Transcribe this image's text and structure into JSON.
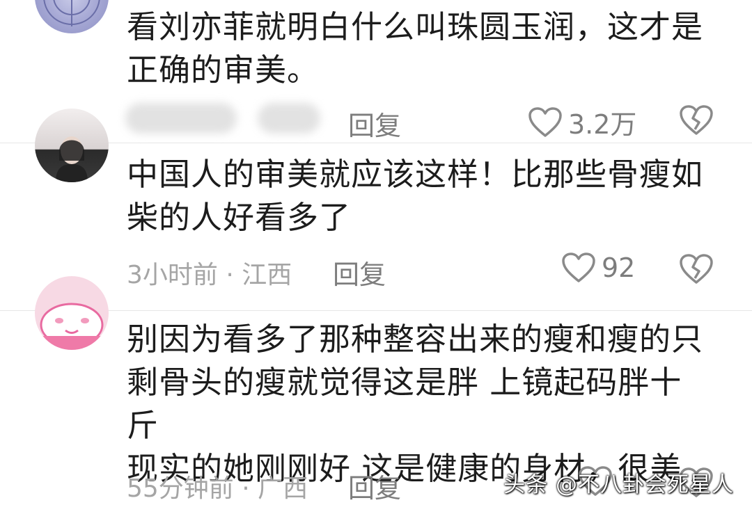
{
  "comments": [
    {
      "text": "看刘亦菲就明白什么叫珠圆玉润，这才是\n正确的审美。",
      "meta": "",
      "reply": "回复",
      "likes": "3.2万"
    },
    {
      "text": "中国人的审美就应该这样！比那些骨瘦如\n柴的人好看多了",
      "meta": "3小时前 · 江西",
      "reply": "回复",
      "likes": "92"
    },
    {
      "text": "别因为看多了那种整容出来的瘦和瘦的只\n剩骨头的瘦就觉得这是胖 上镜起码胖十斤\n现实的她刚刚好 这是健康的身材，很美",
      "meta": "55分钟前 · 广西",
      "reply": "回复",
      "likes": ""
    }
  ],
  "watermark": "头条 @不八卦会死星人",
  "icons": {
    "like": "heart-outline-icon",
    "dislike": "broken-heart-icon"
  },
  "colors": {
    "text": "#1c1c1c",
    "meta": "#a5a5a5",
    "action": "#7d7d7d"
  }
}
